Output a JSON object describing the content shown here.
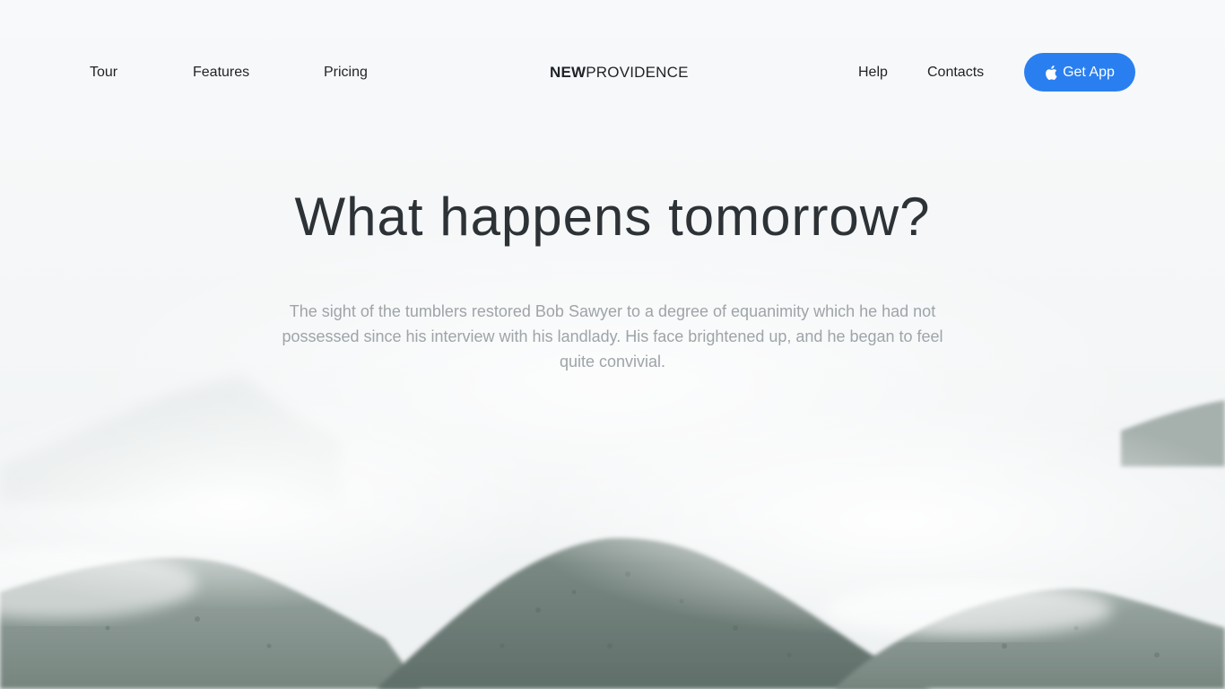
{
  "nav": {
    "left_links": [
      "Tour",
      "Features",
      "Pricing"
    ],
    "brand_bold": "NEW",
    "brand_light": "PROVIDENCE",
    "right_links": [
      "Help",
      "Contacts"
    ],
    "cta_label": "Get App",
    "cta_icon": "apple-icon"
  },
  "hero": {
    "title": "What happens tomorrow?",
    "lead": "The sight of the tumblers restored Bob Sawyer to a degree of equanimity which he had not possessed since his interview with his landlady. His face brightened up, and he began to feel quite convivial."
  },
  "colors": {
    "accent": "#2a7ff0",
    "text_dark": "#1f2326",
    "heading": "#2d3236",
    "muted": "#9ea4a8",
    "background": "#f6f8f9",
    "mountain": "#6f7f78"
  }
}
